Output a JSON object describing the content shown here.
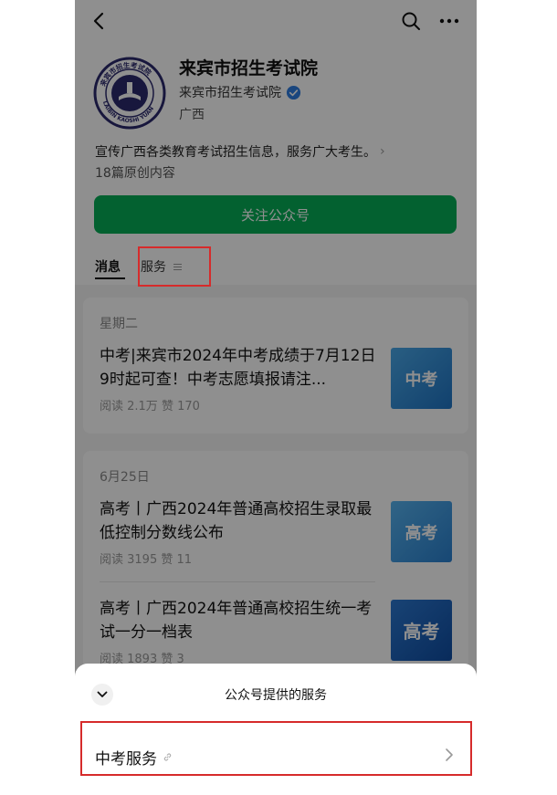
{
  "account": {
    "name": "来宾市招生考试院",
    "verified_name": "来宾市招生考试院",
    "region": "广西",
    "description": "宣传广西各类教育考试招生信息，服务广大考生。",
    "original_count": "18篇原创内容",
    "follow_label": "关注公众号",
    "logo_text": "来宾市招生考试院",
    "logo_text_en": "LAIBIN KAOSHI YUAN"
  },
  "tabs": {
    "messages": "消息",
    "services": "服务"
  },
  "feed": {
    "groups": [
      {
        "date": "星期二",
        "articles": [
          {
            "title": "中考|来宾市2024年中考成绩于7月12日9时起可查！中考志愿填报请注...",
            "meta": "阅读 2.1万  赞 170",
            "thumb_text": "中考"
          }
        ]
      },
      {
        "date": "6月25日",
        "articles": [
          {
            "title": "高考丨广西2024年普通高校招生录取最低控制分数线公布",
            "meta": "阅读 3195  赞 11",
            "thumb_text": "高考"
          },
          {
            "title": "高考丨广西2024年普通高校招生统一考试一分一档表",
            "meta": "阅读 1893  赞 3",
            "thumb_text": "高考"
          }
        ]
      }
    ]
  },
  "sheet": {
    "title": "公众号提供的服务",
    "services": [
      {
        "label": "中考服务"
      }
    ]
  },
  "colors": {
    "accent_green": "#06ad56",
    "highlight_red": "#d62b2b",
    "overlay": "rgba(0,0,0,0.44)"
  },
  "icons": [
    "back-icon",
    "search-icon",
    "more-icon",
    "verified-icon",
    "chevron-right-icon",
    "menu-icon",
    "chevron-down-icon",
    "link-icon"
  ]
}
